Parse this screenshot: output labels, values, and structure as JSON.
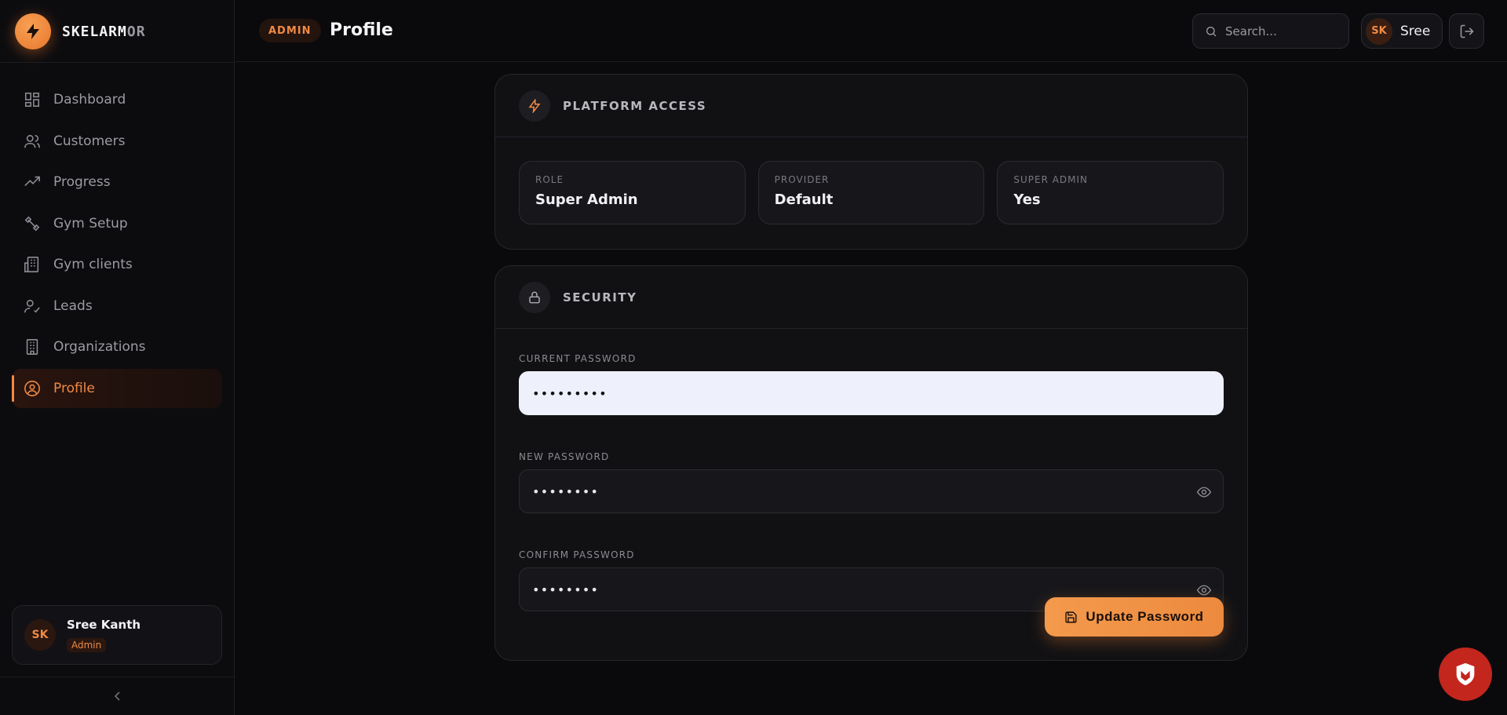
{
  "brand": {
    "name_main": "SKELARM",
    "name_dim": "OR"
  },
  "sidebar": {
    "items": [
      {
        "label": "Dashboard",
        "icon": "grid-icon"
      },
      {
        "label": "Customers",
        "icon": "users-icon"
      },
      {
        "label": "Progress",
        "icon": "trending-up-icon"
      },
      {
        "label": "Gym Setup",
        "icon": "dumbbell-icon"
      },
      {
        "label": "Gym clients",
        "icon": "building-icon"
      },
      {
        "label": "Leads",
        "icon": "user-check-icon"
      },
      {
        "label": "Organizations",
        "icon": "office-icon"
      },
      {
        "label": "Profile",
        "icon": "user-circle-icon"
      }
    ],
    "active": "Profile",
    "user": {
      "initials": "SK",
      "name": "Sree Kanth",
      "role": "Admin"
    }
  },
  "header": {
    "badge": "ADMIN",
    "title": "Profile",
    "search_placeholder": "Search...",
    "user_initials": "SK",
    "user_name": "Sree"
  },
  "platform_access": {
    "title": "PLATFORM ACCESS",
    "fields": [
      {
        "label": "ROLE",
        "value": "Super Admin"
      },
      {
        "label": "PROVIDER",
        "value": "Default"
      },
      {
        "label": "SUPER ADMIN",
        "value": "Yes"
      }
    ]
  },
  "security": {
    "title": "SECURITY",
    "current_label": "CURRENT PASSWORD",
    "current_value": "•••••••••",
    "new_label": "NEW PASSWORD",
    "new_value": "••••••••",
    "confirm_label": "CONFIRM PASSWORD",
    "confirm_value": "••••••••",
    "button_label": "Update Password"
  },
  "colors": {
    "accent": "#f08a44",
    "background": "#0a0a0d",
    "card": "#111114"
  }
}
